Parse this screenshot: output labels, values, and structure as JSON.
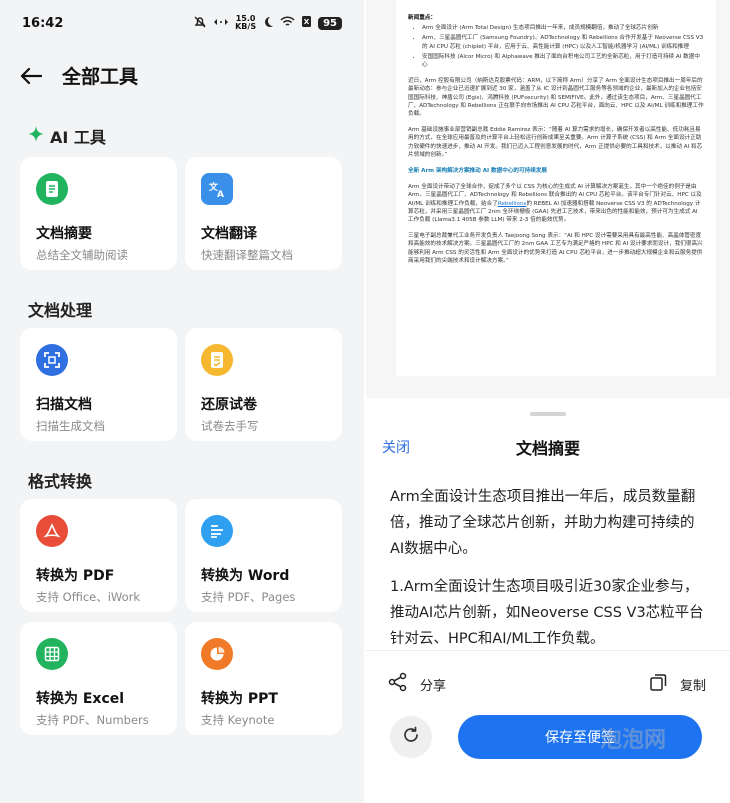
{
  "status": {
    "time": "16:42",
    "speed_top": "15.0",
    "speed_bottom": "KB/S",
    "battery": "95"
  },
  "header": {
    "title": "全部工具"
  },
  "sections": {
    "ai": {
      "title": "AI 工具",
      "cards": [
        {
          "name": "文档摘要",
          "desc": "总结全文辅助阅读"
        },
        {
          "name": "文档翻译",
          "desc": "快速翻译整篇文档"
        }
      ]
    },
    "docproc": {
      "title": "文档处理",
      "cards": [
        {
          "name": "扫描文档",
          "desc": "扫描生成文档"
        },
        {
          "name": "还原试卷",
          "desc": "试卷去手写"
        }
      ]
    },
    "convert": {
      "title": "格式转换",
      "cards": [
        {
          "name": "转换为 PDF",
          "desc": "支持 Office、iWork"
        },
        {
          "name": "转换为 Word",
          "desc": "支持 PDF、Pages"
        },
        {
          "name": "转换为 Excel",
          "desc": "支持 PDF、Numbers"
        },
        {
          "name": "转换为 PPT",
          "desc": "支持 Keynote"
        }
      ]
    }
  },
  "document": {
    "heading": "新闻重点：",
    "bullets": [
      "Arm 全面设计 (Arm Total Design) 生态项目推出一年来，成员规模翻倍，推动了全球芯片创新",
      "Arm、三星晶圆代工厂 (Samsung Foundry)、ADTechnology 和 Rebellions 合作开发基于 Neoverse CSS V3 的 AI CPU 芯粒 (chiplet) 平台，应用于云、高性能计算 (HPC) 以及人工智能/机器学习 (AI/ML) 训练和推理",
      "安国国际科技 (Alcor Micro) 和 Alphawave 推出了面向台积电公司工艺的全新芯粒，用于打造可持续 AI 数据中心"
    ],
    "para1": "近日，Arm 控股有限公司（纳斯达克股票代码：ARM，以下简称 Arm）分享了 Arm 全面设计生态项目推出一周年后的最新动态：参与企业已迅速扩展到近 30 家，涵盖了从 IC 设计到晶圆代工服务等各领域的企业，最新加入的企业包括安国国际科技、神盾公司 (Egis)、鸿腾科技 (PUFsecurity) 和 SEMIFIVE。此外，通过该生态项目，Arm、三星晶圆代工厂、ADTechnology 和 Rebellions 正在联手向市场推出 AI CPU 芯粒平台，面向云、HPC 以及 AI/ML 训练和推理工作负载。",
    "para2": "Arm 基础设施事业部营销副总裁 Eddie Ramirez 表示：“随着 AI 算力需求的增长，确保开发者以高性能、低功耗且易用的方式，在全球应用最普及的计算平台上轻松运行创新成果至关重要。Arm 计算子系统 (CSS) 和 Arm 全面设计正助力软硬件的快速进步，推动 AI 开发。我们已迈入工程创意发展的时代，Arm 正提供必要的工具和技术，以推动 AI 和芯片领域的创新。”",
    "subhead": "全新 Arm 架构解决方案推动 AI 数据中心的可持续发展",
    "para3_a": "Arm 全面设计带动了全球合作，促成了多个以 CSS 为核心的生成式 AI 计算解决方案诞生。其中一个绝佳的例子是由 Arm、三星晶圆代工厂、ADTechnology 和 Rebellions 联合推出的 AI CPU 芯粒平台。该平台专门针对云、HPC 以及 AI/ML 训练和推理工作负载，结合了",
    "para3_link": "Rebellions",
    "para3_b": "的 REBEL AI 加速器和搭载 Neoverse CSS V3 的 ADTechnology 计算芯粒，并采用三星晶圆代工厂 2nm 全环绕栅极 (GAA) 先进工艺技术，带来出色的性能和能效，预计可为生成式 AI 工作负载 (Llama3.1 405B 参数 LLM) 带来 2-3 倍的能效优势。",
    "para4": "三星电子副总裁兼代工业务开发负责人 Taejoong Song 表示：“AI 和 HPC 设计需要采用具有最高性能、高晶体管密度和高能效的技术解决方案。三星晶圆代工厂的 2nm GAA 工艺专为满足严格的 HPC 和 AI 设计要求而设计，我们很高兴能够利用 Arm CSS 的灵活性和 Arm 全面设计的优势来打造 AI CPU 芯粒平台，进一步推动超大规模企业和云服务提供商采用我们的尖端技术和设计解决方案。”"
  },
  "sheet": {
    "close": "关闭",
    "title": "文档摘要",
    "summary_p1": "Arm全面设计生态项目推出一年后，成员数量翻倍，推动了全球芯片创新，并助力构建可持续的AI数据中心。",
    "summary_p2": "1.Arm全面设计生态项目吸引近30家企业参与，推动AI芯片创新，如Neoverse CSS V3芯粒平台针对云、HPC和AI/ML工作负载。",
    "share": "分享",
    "copy": "复制",
    "save": "保存至便签"
  },
  "watermark": "泡泡网",
  "colors": {
    "accent": "#1e74f0",
    "ai_green": "#21b35e",
    "panel_bg": "#f3f4f6"
  }
}
